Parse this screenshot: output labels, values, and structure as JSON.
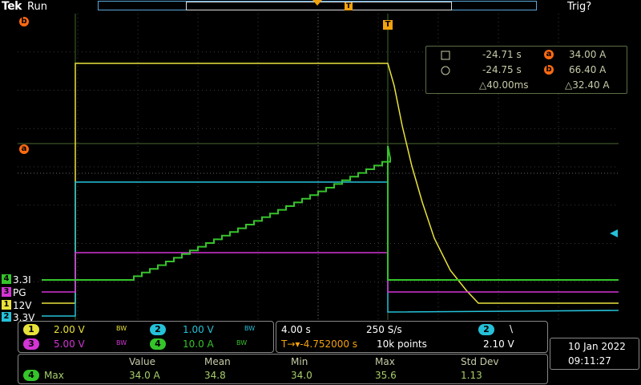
{
  "topbar": {
    "brand": "Tek",
    "run_state": "Run",
    "trigger_state": "Trig?",
    "trigger_marker": "T"
  },
  "cursor_readout": {
    "row1": {
      "time": "-24.71 s",
      "cursor": "a",
      "value": "34.00 A"
    },
    "row2": {
      "time": "-24.75 s",
      "cursor": "b",
      "value": "66.40 A"
    },
    "delta_time": "△40.00ms",
    "delta_value": "△32.40 A"
  },
  "cursor_markers": {
    "a": "a",
    "b": "b",
    "trigger": "T"
  },
  "channels": [
    {
      "id": "4",
      "label": "3.3I",
      "color": "#35c42a"
    },
    {
      "id": "3",
      "label": "PG",
      "color": "#d334d6"
    },
    {
      "id": "1",
      "label": "12V",
      "color": "#e9e23a"
    },
    {
      "id": "2",
      "label": "3.3V",
      "color": "#25c1d8"
    }
  ],
  "vertical_settings": {
    "ch1": {
      "id": "1",
      "scale": "2.00 V",
      "bw": "BW"
    },
    "ch2": {
      "id": "2",
      "scale": "1.00 V",
      "bw": "BW"
    },
    "ch3": {
      "id": "3",
      "scale": "5.00 V",
      "bw": "BW"
    },
    "ch4": {
      "id": "4",
      "scale": "10.0 A",
      "bw": "BW"
    }
  },
  "horizontal": {
    "time_div": "4.00 s",
    "sample_rate": "250 S/s",
    "trigger_position": "T→▾-4.752000 s",
    "record_length": "10k points"
  },
  "trigger": {
    "source": "2",
    "slope": "\\",
    "level": "2.10 V"
  },
  "measurements": {
    "headers": {
      "value": "Value",
      "mean": "Mean",
      "min": "Min",
      "max": "Max",
      "std": "Std Dev"
    },
    "rows": [
      {
        "channel": "4",
        "type": "Max",
        "value": "34.0 A",
        "mean": "34.8",
        "min": "34.0",
        "max": "35.6",
        "std": "1.13"
      }
    ]
  },
  "datetime": {
    "date": "10 Jan  2022",
    "time": "09:11:27"
  },
  "colors": {
    "ch1": "#e9e23a",
    "ch2": "#25c1d8",
    "ch3": "#d334d6",
    "ch4": "#35c42a",
    "cursor": "#ff6a12",
    "trigger": "#f2a20c",
    "grid": "#3a3a3a"
  }
}
